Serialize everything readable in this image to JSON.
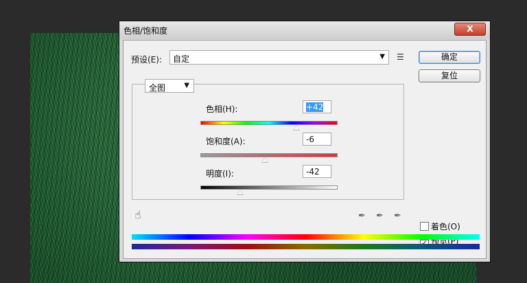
{
  "dialog": {
    "title": "色相/饱和度",
    "close_label": "X"
  },
  "preset": {
    "label": "预设(E):",
    "value": "自定",
    "arrow": "▼",
    "menu_icon": "☰"
  },
  "buttons": {
    "ok_label": "确定",
    "reset_label": "复位"
  },
  "range": {
    "value": "全图",
    "arrow": "▼"
  },
  "sliders": {
    "hue": {
      "label": "色相(H):",
      "value": "+42",
      "fraction": 0.7
    },
    "saturation": {
      "label": "饱和度(A):",
      "value": "-6",
      "fraction": 0.47
    },
    "lightness": {
      "label": "明度(I):",
      "value": "-42",
      "fraction": 0.29
    }
  },
  "tools": {
    "hand_icon": "☝",
    "eyedropper": "✒",
    "eyedropper_plus": "✒",
    "eyedropper_minus": "✒"
  },
  "options": {
    "colorize_label": "着色(O)",
    "colorize_checked": false,
    "preview_label": "预览(P)",
    "preview_checked": true,
    "check_mark": "✓"
  },
  "colors": {
    "background": "#2b2b2b",
    "grass": "#1e5a31",
    "selection": "#3399ff"
  }
}
